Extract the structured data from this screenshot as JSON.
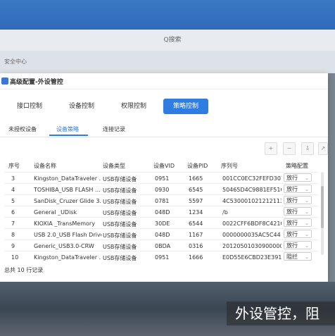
{
  "search": {
    "placeholder": "Q搜索"
  },
  "background_title": "安全中心",
  "dialog": {
    "title": "高级配置-外设管控",
    "main_tabs": [
      "接口控制",
      "设备控制",
      "权限控制",
      "策略控制"
    ],
    "active_main_tab": "策略控制",
    "sub_tabs": [
      "未授权设备",
      "设备策略",
      "连接记录"
    ],
    "active_sub_tab": "设备策略",
    "toolbar_icons": [
      "add-icon",
      "remove-icon",
      "import-icon",
      "export-icon"
    ],
    "columns": [
      "序号",
      "设备名称",
      "设备类型",
      "设备VID",
      "设备PID",
      "序列号",
      "策略配置"
    ],
    "rows": [
      {
        "no": "3",
        "name": "Kingston_DataTraveler …",
        "type": "USB存储设备",
        "vid": "0951",
        "pid": "1665",
        "serial": "001CC0EC32FEFD307…",
        "policy": "放行"
      },
      {
        "no": "4",
        "name": "TOSHIBA_USB FLASH …",
        "type": "USB存储设备",
        "vid": "0930",
        "pid": "6545",
        "serial": "50465D4C9881EF51C…",
        "policy": "放行"
      },
      {
        "no": "5",
        "name": "SanDisk_Cruzer Glide 3.0",
        "type": "USB存储设备",
        "vid": "0781",
        "pid": "5597",
        "serial": "4C530001021212113…",
        "policy": "放行"
      },
      {
        "no": "6",
        "name": "General _UDisk",
        "type": "USB存储设备",
        "vid": "048D",
        "pid": "1234",
        "serial": "/b",
        "policy": "放行"
      },
      {
        "no": "7",
        "name": "KIOXIA _TransMemory",
        "type": "USB存储设备",
        "vid": "30DE",
        "pid": "6544",
        "serial": "0022CFF6BDF8C421C…",
        "policy": "放行"
      },
      {
        "no": "8",
        "name": "USB 2.0_USB Flash Drive",
        "type": "USB存储设备",
        "vid": "048D",
        "pid": "1167",
        "serial": "0000000035AC5C44",
        "policy": "放行"
      },
      {
        "no": "9",
        "name": "Generic_USB3.0-CRW",
        "type": "USB存储设备",
        "vid": "0BDA",
        "pid": "0316",
        "serial": "20120501030900000",
        "policy": "放行"
      },
      {
        "no": "10",
        "name": "Kingston_DataTraveler …",
        "type": "USB存储设备",
        "vid": "0951",
        "pid": "1666",
        "serial": "E0D55E6CBD23E391…",
        "policy": "阻拦"
      }
    ],
    "footer": "总共 10 行记录"
  },
  "caption": "外设管控，阻",
  "colors": {
    "accent": "#2f7de1",
    "topbar": "#3b78c4"
  }
}
